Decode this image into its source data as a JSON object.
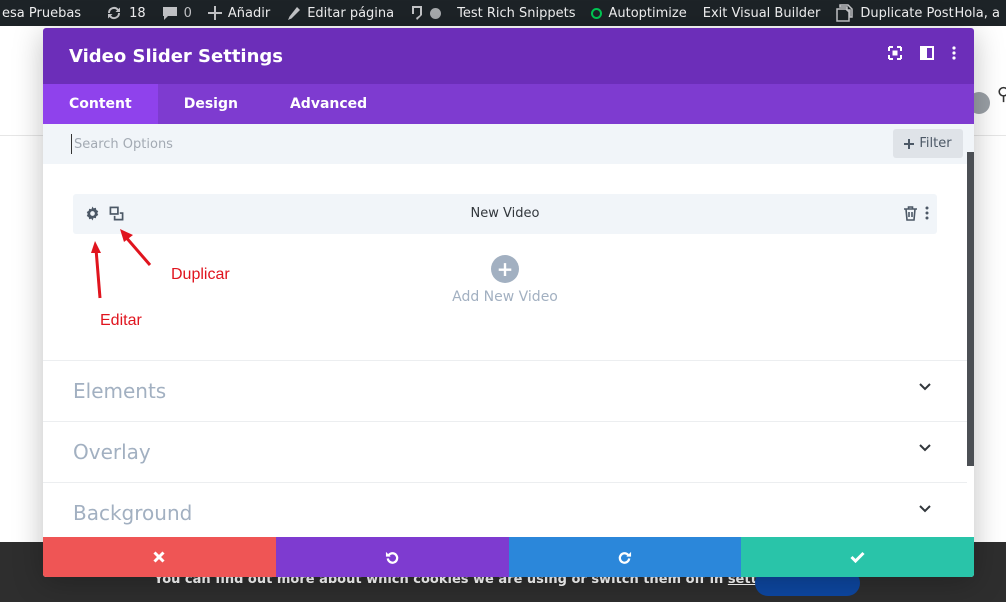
{
  "adminbar": {
    "site_name": "esa Pruebas",
    "updates_count": "18",
    "comments_count": "0",
    "add_new": "Añadir",
    "edit_page": "Editar página",
    "rich_snippets": "Test Rich Snippets",
    "autoptimize": "Autoptimize",
    "exit_builder": "Exit Visual Builder",
    "duplicate_post": "Duplicate Post",
    "howdy": "Hola, a"
  },
  "modal": {
    "title": "Video Slider Settings",
    "tabs": [
      {
        "label": "Content",
        "active": true
      },
      {
        "label": "Design",
        "active": false
      },
      {
        "label": "Advanced",
        "active": false
      }
    ],
    "search_placeholder": "Search Options",
    "filter_label": "Filter",
    "item_title": "New Video",
    "add_new_label": "Add New Video",
    "toggles": [
      {
        "title": "Elements"
      },
      {
        "title": "Overlay"
      },
      {
        "title": "Background"
      }
    ]
  },
  "annotations": {
    "duplicate": "Duplicar",
    "edit": "Editar"
  },
  "cookie": {
    "text_prefix": "You can find out more about which cookies we are using or switch them off in ",
    "settings_link": "settings",
    "text_suffix": "."
  },
  "colors": {
    "header": "#6c2eb9",
    "tabs": "#7e3bd0",
    "tab_active": "#8f42ec",
    "discard": "#ef5555",
    "undo": "#7e3bd0",
    "redo": "#2b87da",
    "save": "#29c4a9",
    "annotation": "#e0141e"
  }
}
